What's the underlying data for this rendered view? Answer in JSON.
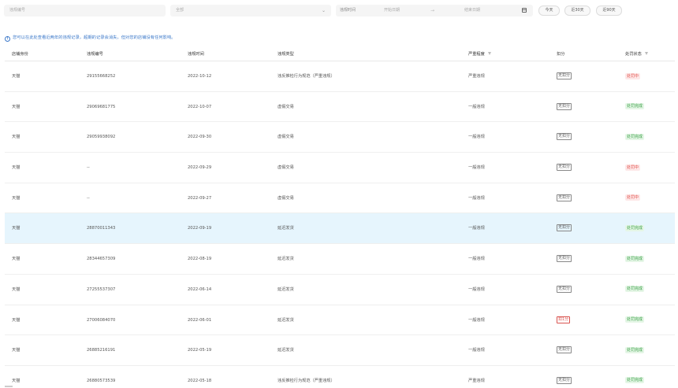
{
  "filters": {
    "violation_id_placeholder": "违规编号",
    "type_select_value": "全部",
    "date_label": "违规时间",
    "start_placeholder": "开始日期",
    "end_placeholder": "结束日期",
    "quick": [
      "今天",
      "近30天",
      "近90天"
    ]
  },
  "notice": "您可以在此处查看近两年的违规记录，超期的记录会消失，但对您的店铺没有任何影响。",
  "columns": [
    "店铺身份",
    "违规编号",
    "违规时间",
    "违规类型",
    "严重程度",
    "扣分",
    "处罚状态"
  ],
  "rows": [
    {
      "shop": "天猫",
      "id": "29155668252",
      "time": "2022-10-12",
      "type": "违反推检行为规范（严重违规）",
      "severity": "严重违规",
      "points": "无扣分",
      "points_red": false,
      "status": "处罚中",
      "status_kind": "proc"
    },
    {
      "shop": "天猫",
      "id": "29069681775",
      "time": "2022-10-07",
      "type": "虚假交易",
      "severity": "一般违规",
      "points": "无扣分",
      "points_red": false,
      "status": "处罚完成",
      "status_kind": "done"
    },
    {
      "shop": "天猫",
      "id": "29059938092",
      "time": "2022-09-30",
      "type": "虚假交易",
      "severity": "一般违规",
      "points": "无扣分",
      "points_red": false,
      "status": "处罚完成",
      "status_kind": "done"
    },
    {
      "shop": "天猫",
      "id": "--",
      "time": "2022-09-29",
      "type": "虚假交易",
      "severity": "一般违规",
      "points": "无扣分",
      "points_red": false,
      "status": "处罚中",
      "status_kind": "proc"
    },
    {
      "shop": "天猫",
      "id": "--",
      "time": "2022-09-27",
      "type": "虚假交易",
      "severity": "一般违规",
      "points": "无扣分",
      "points_red": false,
      "status": "处罚中",
      "status_kind": "proc"
    },
    {
      "shop": "天猫",
      "id": "28870011343",
      "time": "2022-09-19",
      "type": "延迟发货",
      "severity": "一般违规",
      "points": "无扣分",
      "points_red": false,
      "status": "处罚完成",
      "status_kind": "done",
      "highlight": true
    },
    {
      "shop": "天猫",
      "id": "28344657309",
      "time": "2022-08-19",
      "type": "延迟发货",
      "severity": "一般违规",
      "points": "无扣分",
      "points_red": false,
      "status": "处罚完成",
      "status_kind": "done"
    },
    {
      "shop": "天猫",
      "id": "27255537307",
      "time": "2022-06-14",
      "type": "延迟发货",
      "severity": "一般违规",
      "points": "无扣分",
      "points_red": false,
      "status": "处罚完成",
      "status_kind": "done"
    },
    {
      "shop": "天猫",
      "id": "27006084070",
      "time": "2022-06-01",
      "type": "延迟发货",
      "severity": "一般违规",
      "points": "扣1分",
      "points_red": true,
      "status": "处罚完成",
      "status_kind": "done"
    },
    {
      "shop": "天猫",
      "id": "26885216191",
      "time": "2022-05-19",
      "type": "延迟发货",
      "severity": "一般违规",
      "points": "无扣分",
      "points_red": false,
      "status": "处罚完成",
      "status_kind": "done"
    },
    {
      "shop": "天猫",
      "id": "26880573539",
      "time": "2022-05-18",
      "type": "违反推检行为规范（严重违规）",
      "severity": "严重违规",
      "points": "无扣分",
      "points_red": false,
      "status": "处罚完成",
      "status_kind": "done"
    }
  ]
}
